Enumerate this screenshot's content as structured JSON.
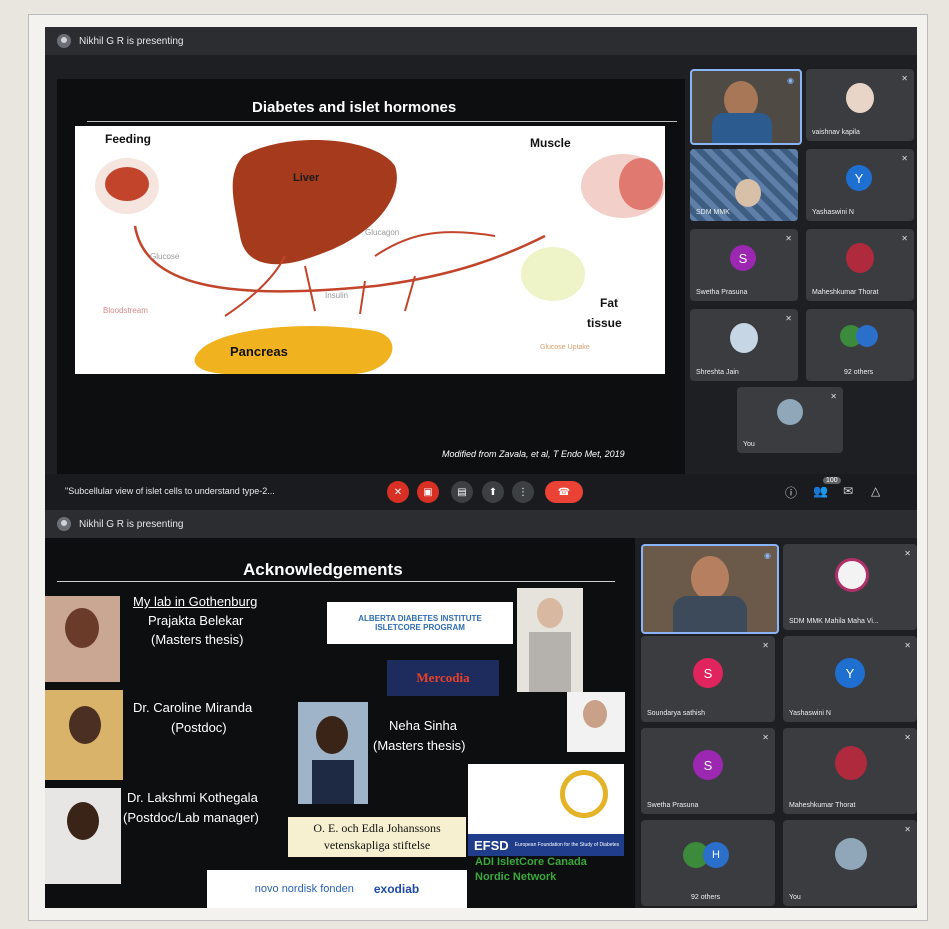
{
  "meeting1": {
    "presenting": "Nikhil G R is presenting",
    "slide": {
      "title": "Diabetes and islet hormones",
      "feeding": "Feeding",
      "liver": "Liver",
      "muscle": "Muscle",
      "fat": "Fat",
      "tissue": "tissue",
      "pancreas": "Pancreas",
      "glucose": "Glucose",
      "glucagon": "Glucagon",
      "insulin": "Insulin",
      "bloodstream": "Bloodstream",
      "glucose_uptake": "Glucose Uptake",
      "citation": "Modified from Zavala, et al, T Endo Met, 2019"
    },
    "participants": [
      {
        "name": "",
        "type": "video"
      },
      {
        "name": "vaishnav kapila",
        "type": "photo"
      },
      {
        "name": "SDM MMK",
        "type": "video"
      },
      {
        "name": "Yashaswini N",
        "type": "avatar",
        "initial": "Y",
        "color": "#1f6fd1"
      },
      {
        "name": "Swetha Prasuna",
        "type": "avatar",
        "initial": "S",
        "color": "#9c27b0"
      },
      {
        "name": "Maheshkumar Thorat",
        "type": "photo"
      },
      {
        "name": "Shreshta Jain",
        "type": "photo"
      },
      {
        "name": "92 others",
        "type": "others"
      }
    ],
    "self_label": "You",
    "caption": "\"Subcellular view of islet cells to understand type-2...",
    "people_count": "100"
  },
  "meeting2": {
    "presenting": "Nikhil G R is presenting",
    "slide": {
      "title": "Acknowledgements",
      "lab": "My lab in Gothenburg",
      "p1_name": "Prajakta Belekar",
      "p1_role": "(Masters thesis)",
      "p2_name": "Dr. Caroline Miranda",
      "p2_role": "(Postdoc)",
      "p3_name": "Dr. Lakshmi Kothegala",
      "p3_role": "(Postdoc/Lab manager)",
      "p4_name": "Neha Sinha",
      "p4_role": "(Masters thesis)",
      "alberta_1": "ALBERTA DIABETES INSTITUTE",
      "alberta_2": "ISLETCORE PROGRAM",
      "mercodia": "Mercodia",
      "oe_1": "O. E. och Edla Johanssons",
      "oe_2": "vetenskapliga stiftelse",
      "efsd": "EFSD",
      "efsd_sub": "European Foundation for the Study of Diabetes",
      "adi": "ADI IsletCore Canada",
      "nordic": "Nordic Network",
      "novo": "novo nordisk fonden",
      "exodiab": "exodiab"
    },
    "participants": [
      {
        "name": "",
        "type": "video"
      },
      {
        "name": "SDM MMK Mahila Maha Vi...",
        "type": "photo"
      },
      {
        "name": "Soundarya sathish",
        "type": "avatar",
        "initial": "S",
        "color": "#e0245e"
      },
      {
        "name": "Yashaswini N",
        "type": "avatar",
        "initial": "Y",
        "color": "#1f6fd1"
      },
      {
        "name": "Swetha Prasuna",
        "type": "avatar",
        "initial": "S",
        "color": "#9c27b0"
      },
      {
        "name": "Maheshkumar Thorat",
        "type": "photo"
      },
      {
        "name": "92 others",
        "type": "others"
      },
      {
        "name": "You",
        "type": "photo"
      }
    ]
  },
  "colors": {
    "end_call": "#ea4335",
    "muted": "#d93025",
    "accent": "#8ab4f8"
  }
}
